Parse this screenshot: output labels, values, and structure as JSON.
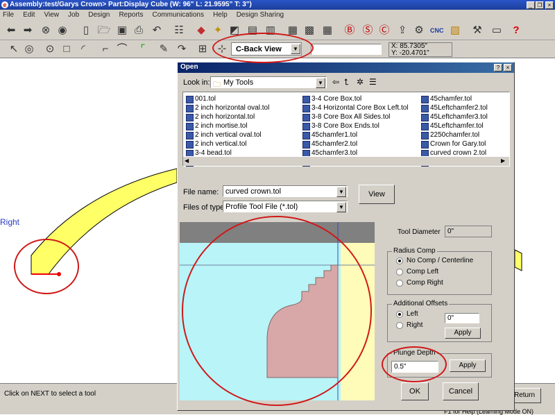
{
  "window": {
    "title": "Assembly:test/Garys Crown> Part:Display Cube (W: 96\" L: 21.9595\" T: 3\")"
  },
  "menu": [
    "File",
    "Edit",
    "View",
    "Job",
    "Design",
    "Reports",
    "Communications",
    "Help",
    "Design Sharing"
  ],
  "toolbar": {
    "view_combo": "C-Back View",
    "coord_x": "X: 85.7305\"",
    "coord_y": "Y: -20.4701\"",
    "cnc_label": "CNC"
  },
  "canvas": {
    "side_label": "Right"
  },
  "status": {
    "message": "Click on NEXT to select a tool",
    "help": "F1 for Help (Learning Mode ON)",
    "return_button": "Return"
  },
  "dialog": {
    "title": "Open",
    "look_in_label": "Look in:",
    "look_in_value": "My Tools",
    "files": [
      [
        "001.tol",
        "2 inch horizontal oval.tol",
        "2 inch horizontal.tol",
        "2 inch mortise.tol",
        "2 inch vertical oval.tol",
        "2 inch vertical.tol",
        "3-4 bead.tol",
        "3-4 Core Box Ends.tol"
      ],
      [
        "3-4 Core Box.tol",
        "3-4 Horizontal Core Box Left.tol",
        "3-8 Core Box All Sides.tol",
        "3-8 Core Box Ends.tol",
        "45chamfer1.tol",
        "45chamfer2.tol",
        "45chamfer3.tol",
        "45chamfer4.tol"
      ],
      [
        "45chamfer.tol",
        "45Leftchamfer2.tol",
        "45Leftchamfer3.tol",
        "45Leftchamfer.tol",
        "2250chamfer.tol",
        "Crown for Gary.tol",
        "curved crown 2.tol",
        "curved crown.tol"
      ]
    ],
    "file_name_label": "File name:",
    "file_name_value": "curved crown.tol",
    "files_of_type_label": "Files of type:",
    "files_of_type_value": "Profile Tool File (*.tol)",
    "view_button": "View",
    "tool_diameter_label": "Tool Diameter",
    "tool_diameter_value": "0\"",
    "radius_comp": {
      "title": "Radius Comp",
      "options": [
        "No Comp / Centerline",
        "Comp Left",
        "Comp Right"
      ],
      "selected": 0
    },
    "additional_offsets": {
      "title": "Additional Offsets",
      "options": [
        "Left",
        "Right"
      ],
      "selected": 0,
      "value": "0\"",
      "apply": "Apply"
    },
    "plunge_depth": {
      "title": "Plunge Depth",
      "value": "0.5\"",
      "apply": "Apply"
    },
    "ok_button": "OK",
    "cancel_button": "Cancel"
  }
}
